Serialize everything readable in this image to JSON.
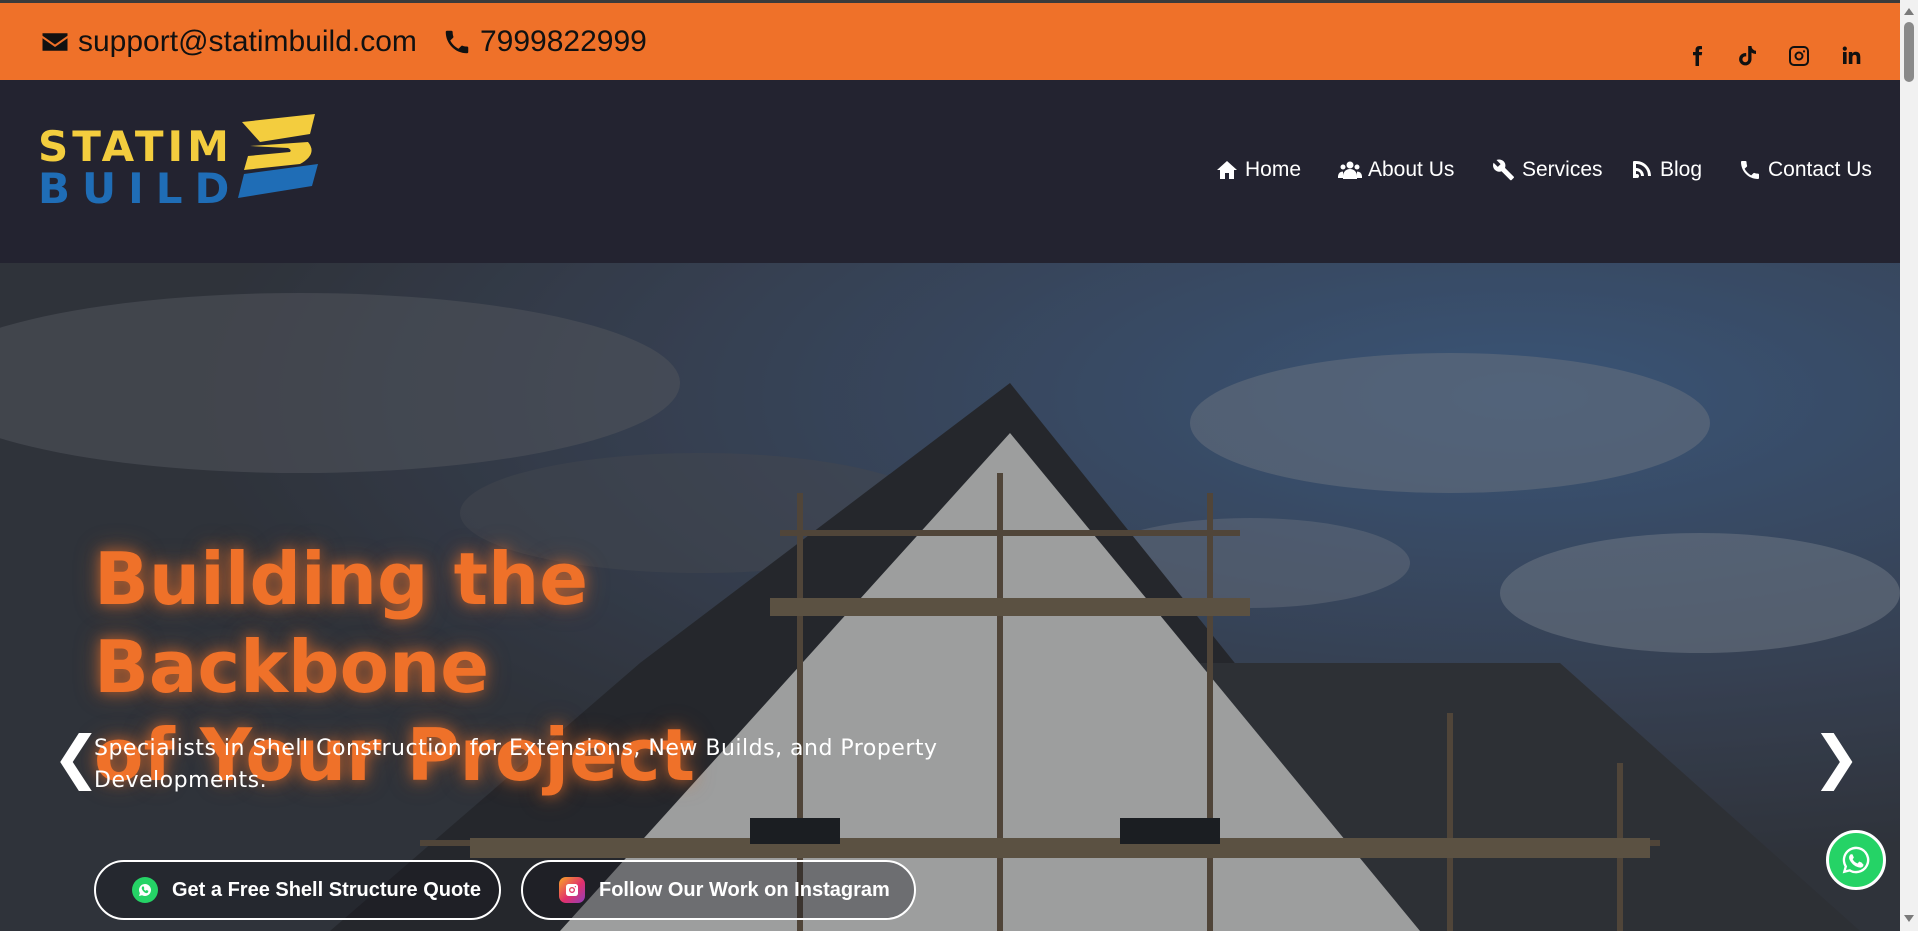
{
  "topbar": {
    "email": "support@statimbuild.com",
    "phone": "7999822999",
    "icons": {
      "email": "envelope-icon",
      "phone": "phone-icon"
    },
    "social": [
      "facebook-icon",
      "tiktok-icon",
      "instagram-icon",
      "linkedin-icon"
    ],
    "background": "#ef7129"
  },
  "logo": {
    "line1": "STATIM",
    "line2": "BUILD",
    "colors": {
      "primary": "#f3cd3e",
      "secondary": "#1f6db6"
    }
  },
  "nav": {
    "items": [
      {
        "label": "Home",
        "icon": "home-icon"
      },
      {
        "label": "About Us",
        "icon": "users-icon"
      },
      {
        "label": "Services",
        "icon": "tools-icon"
      },
      {
        "label": "Blog",
        "icon": "blog-icon"
      },
      {
        "label": "Contact Us",
        "icon": "phone-icon"
      }
    ],
    "background": "#232330"
  },
  "hero": {
    "title_line1": "Building the Backbone",
    "title_line2": "of Your Project",
    "subtitle": "Specialists in Shell Construction for Extensions, New Builds, and Property Developments.",
    "prev_arrow": "❮",
    "next_arrow": "❯",
    "cta_quote": "Get a Free Shell Structure Quote",
    "cta_instagram": "Follow Our Work on Instagram",
    "accent": "#ef7129"
  },
  "floating": {
    "whatsapp_icon": "whatsapp-icon"
  }
}
